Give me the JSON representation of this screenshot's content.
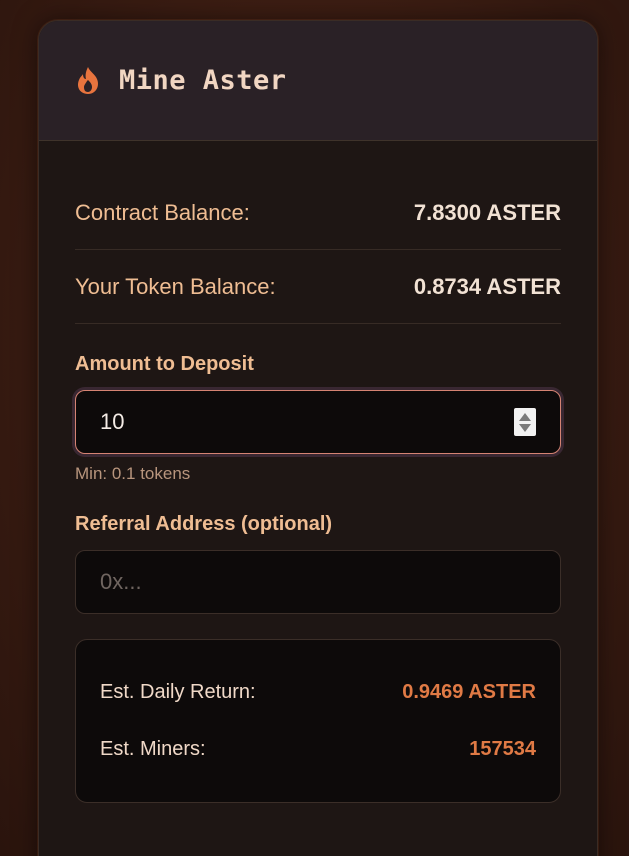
{
  "header": {
    "title": "Mine Aster",
    "icon": "flame-icon",
    "accent_color": "#e8743e"
  },
  "balances": [
    {
      "label": "Contract Balance:",
      "value": "7.8300 ASTER"
    },
    {
      "label": "Your Token Balance:",
      "value": "0.8734 ASTER"
    }
  ],
  "deposit": {
    "label": "Amount to Deposit",
    "value": "10",
    "hint": "Min: 0.1 tokens"
  },
  "referral": {
    "label": "Referral Address (optional)",
    "placeholder": "0x..."
  },
  "estimates": [
    {
      "label": "Est. Daily Return:",
      "value": "0.9469 ASTER"
    },
    {
      "label": "Est. Miners:",
      "value": "157534"
    }
  ]
}
